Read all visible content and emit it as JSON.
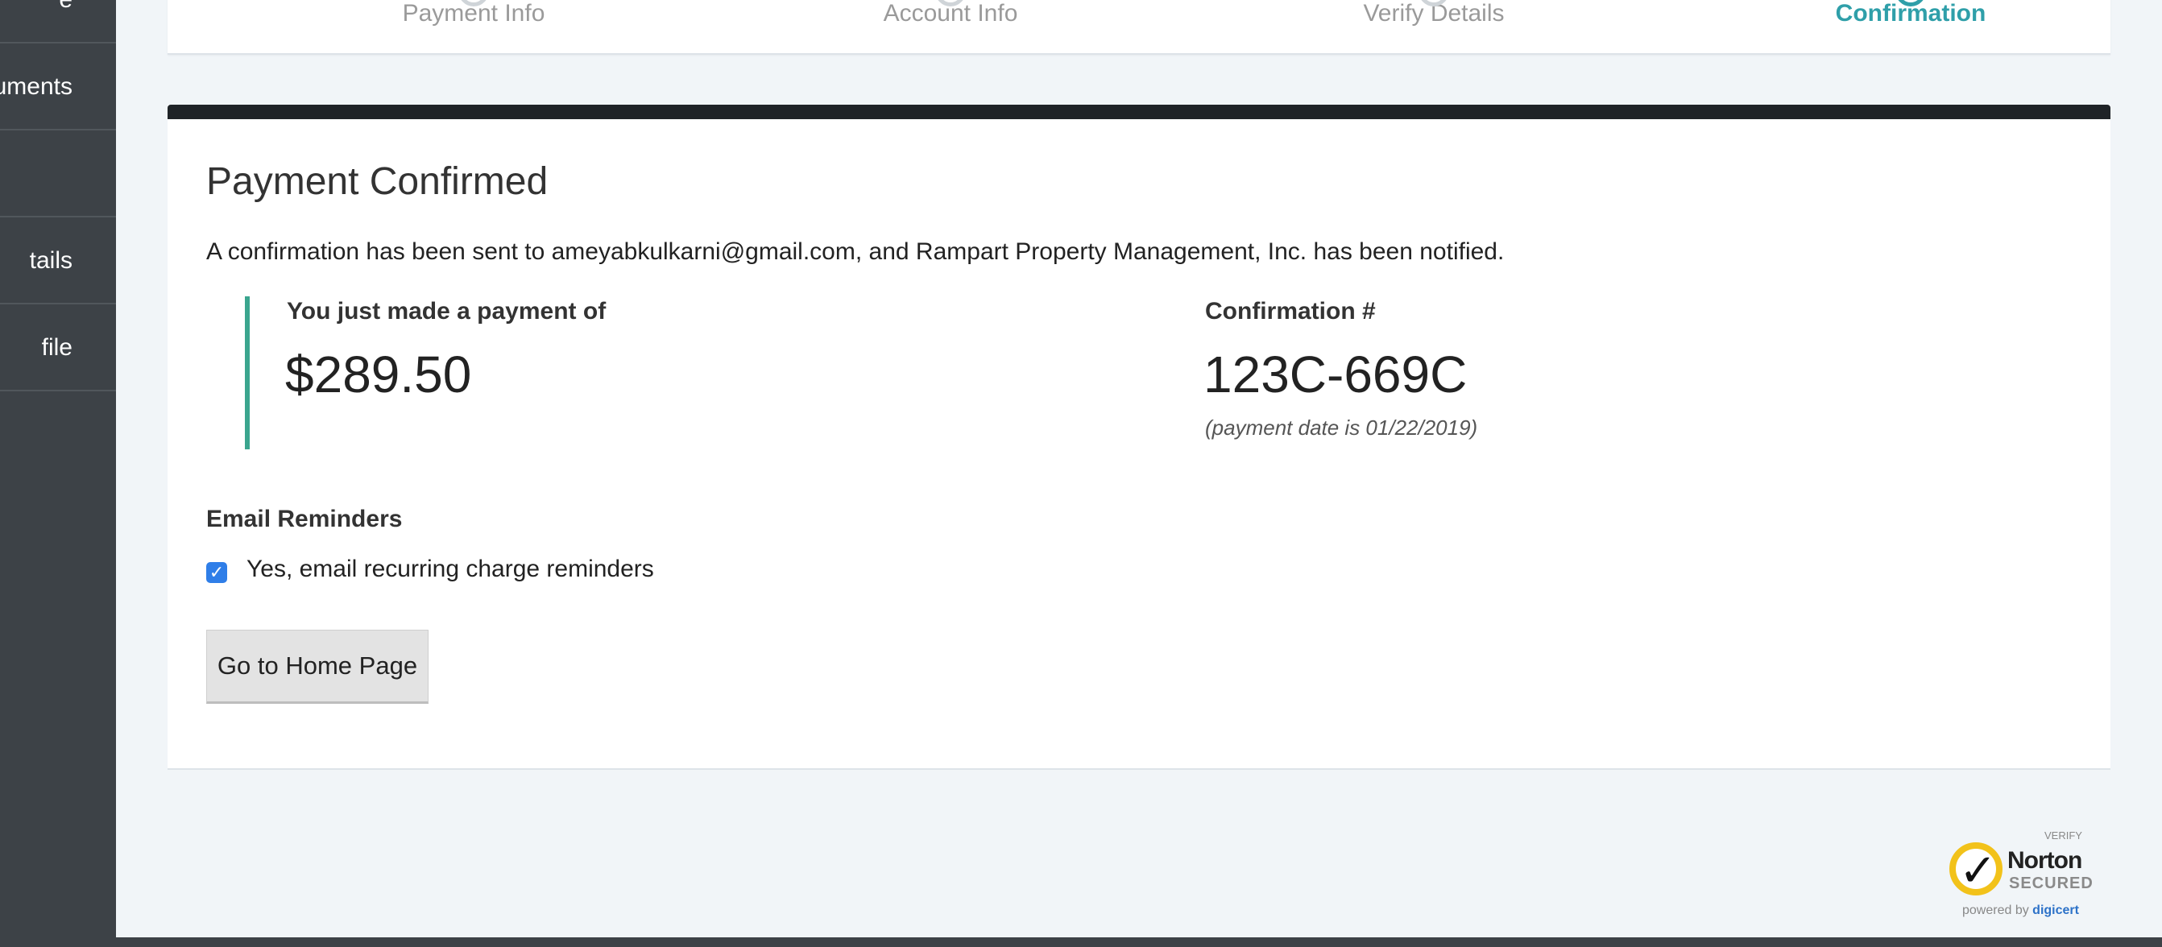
{
  "sidebar": {
    "items": [
      {
        "label": "e"
      },
      {
        "label": "uments"
      },
      {
        "label": ""
      },
      {
        "label": "tails"
      },
      {
        "label": "file"
      }
    ]
  },
  "stepper": {
    "steps": [
      {
        "label": "Payment Info",
        "active": false
      },
      {
        "label": "Account Info",
        "active": false
      },
      {
        "label": "Verify Details",
        "active": false
      },
      {
        "label": "Confirmation",
        "active": true
      }
    ],
    "active_color": "#2f9fa9"
  },
  "confirmation": {
    "title": "Payment Confirmed",
    "notice": "A confirmation has been sent to ameyabkulkarni@gmail.com, and Rampart Property Management, Inc. has been notified.",
    "payment_label": "You just made a payment of",
    "payment_amount": "$289.50",
    "confirmation_label": "Confirmation #",
    "confirmation_number": "123C-669C",
    "payment_date_note": "(payment date is 01/22/2019)"
  },
  "reminders": {
    "heading": "Email Reminders",
    "checkbox_label": "Yes, email recurring charge reminders",
    "checked": true
  },
  "actions": {
    "home_button": "Go to Home Page"
  },
  "badge": {
    "verify": "VERIFY",
    "name": "Norton",
    "secured": "SECURED",
    "powered_prefix": "powered by",
    "powered_brand": "digicert"
  },
  "colors": {
    "sidebar": "#3d4247",
    "accent_teal": "#2f9fa9",
    "payment_border": "#3aa58e",
    "checkbox": "#2f7ee8"
  }
}
